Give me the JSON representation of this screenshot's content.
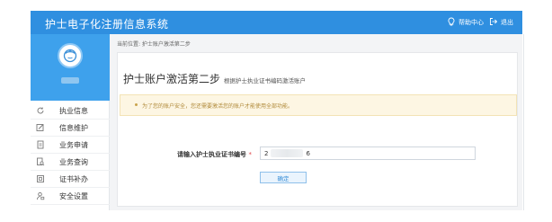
{
  "header": {
    "title": "护士电子化注册信息系统",
    "help_label": "帮助中心",
    "logout_label": "退出"
  },
  "sidebar": {
    "items": [
      {
        "label": "执业信息",
        "icon": "refresh-icon"
      },
      {
        "label": "信息维护",
        "icon": "edit-icon"
      },
      {
        "label": "业务申请",
        "icon": "document-icon"
      },
      {
        "label": "业务查询",
        "icon": "search-doc-icon"
      },
      {
        "label": "证书补办",
        "icon": "certificate-icon"
      },
      {
        "label": "安全设置",
        "icon": "user-lock-icon"
      }
    ]
  },
  "main": {
    "breadcrumb": "当前位置: 护士账户激活第二步",
    "title": "护士账户激活第二步",
    "subtitle": "根据护士执业证书编码激活账户",
    "alert": "为了您的账户安全，您还需要激活您的账户才能使用全部功能。",
    "form": {
      "label": "请输入护士执业证书编号",
      "required_mark": "*",
      "value_prefix": "2",
      "value_suffix": "6"
    },
    "confirm_label": "确定"
  },
  "colors": {
    "topbar": "#2f8fe0",
    "profile": "#3ea1ec",
    "alert_bg": "#fdf6e3",
    "alert_text": "#b08a3a"
  }
}
